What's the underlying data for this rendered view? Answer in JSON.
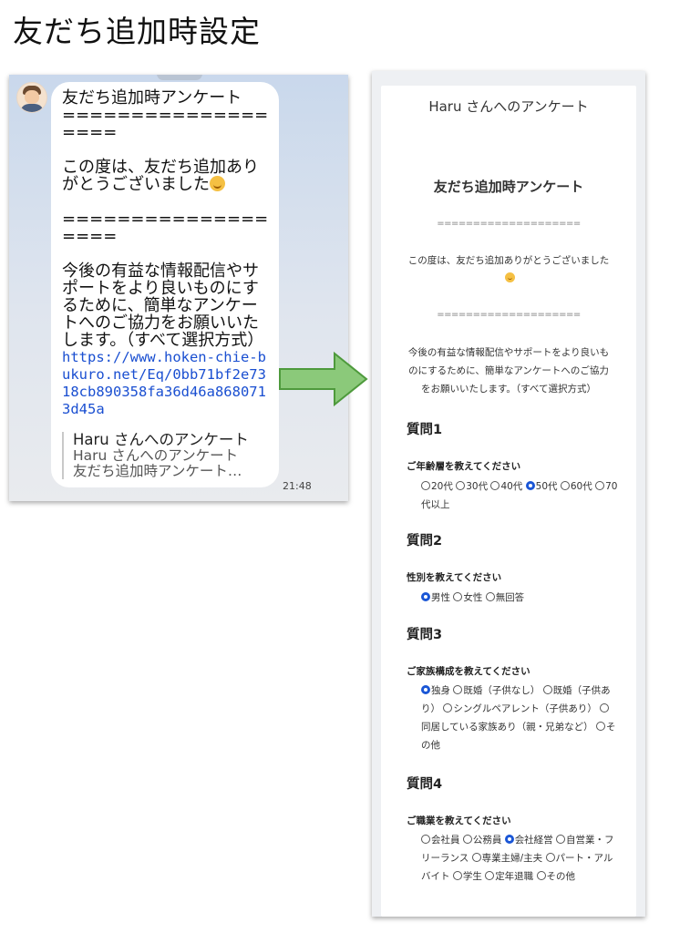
{
  "page": {
    "title": "友だち追加時設定"
  },
  "chat": {
    "line1": "友だち追加時アンケート",
    "sep1": "===================",
    "line2": "この度は、友だち追加ありがとうございました",
    "sep2": "===================",
    "line3": "今後の有益な情報配信やサポートをより良いものにするために、簡単なアンケートへのご協力をお願いいたします。（すべて選択方式）",
    "link": "https://www.hoken-chie-bukuro.net/Eq/0bb71bf2e7318cb890358fa36d46a8680713d45a",
    "quote_title": "Haru さんへのアンケート",
    "quote_sub1": "Haru さんへのアンケート",
    "quote_sub2": "友だち追加時アンケート…",
    "time": "21:48"
  },
  "survey": {
    "header": "Haru さんへのアンケート",
    "heading": "友だち追加時アンケート",
    "sep": "====================",
    "intro1": "この度は、友だち追加ありがとうございました",
    "intro2": "今後の有益な情報配信やサポートをより良いものにするために、簡単なアンケートへのご協力をお願いいたします。（すべて選択方式）",
    "questions": [
      {
        "num": "質問1",
        "label": "ご年齢層を教えてください",
        "options": [
          "20代",
          "30代",
          "40代",
          "50代",
          "60代",
          "70代以上"
        ],
        "selected": "50代"
      },
      {
        "num": "質問2",
        "label": "性別を教えてください",
        "options": [
          "男性",
          "女性",
          "無回答"
        ],
        "selected": "男性"
      },
      {
        "num": "質問3",
        "label": "ご家族構成を教えてください",
        "options": [
          "独身",
          "既婚（子供なし）",
          "既婚（子供あり）",
          "シングルペアレント（子供あり）",
          "同居している家族あり（親・兄弟など）",
          "その他"
        ],
        "selected": "独身"
      },
      {
        "num": "質問4",
        "label": "ご職業を教えてください",
        "options": [
          "会社員",
          "公務員",
          "会社経営",
          "自営業・フリーランス",
          "専業主婦/主夫",
          "パート・アルバイト",
          "学生",
          "定年退職",
          "その他"
        ],
        "selected": "会社経営"
      }
    ]
  },
  "colors": {
    "radio_selected": "#1a56d6",
    "arrow_fill": "#8bc97a",
    "arrow_stroke": "#4e9a3c",
    "link": "#1a4fd1"
  }
}
